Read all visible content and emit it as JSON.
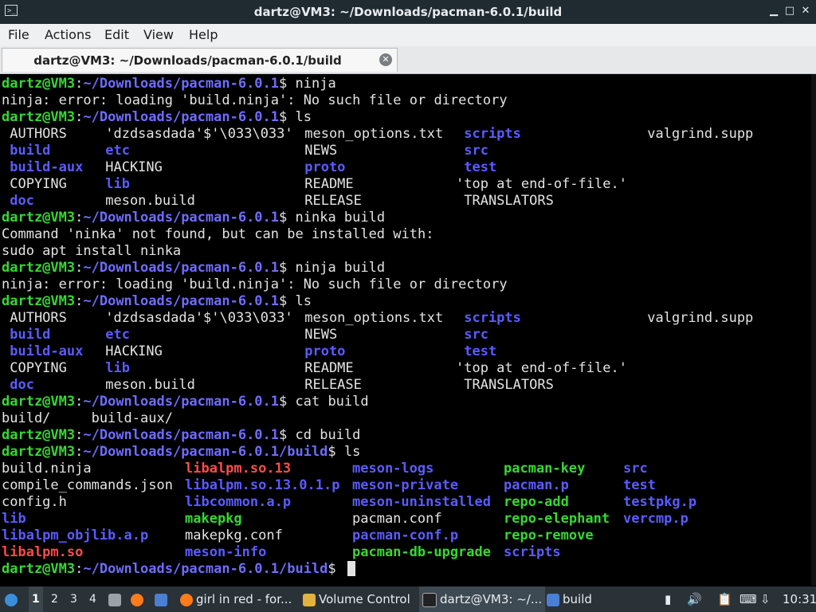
{
  "window": {
    "title": "dartz@VM3: ~/Downloads/pacman-6.0.1/build"
  },
  "menu": [
    "File",
    "Actions",
    "Edit",
    "View",
    "Help"
  ],
  "tab": {
    "label": "dartz@VM3: ~/Downloads/pacman-6.0.1/build"
  },
  "terminal": {
    "prompt_user": "dartz@VM3",
    "prompt_path1": "~/Downloads/pacman-6.0.1",
    "prompt_path2": "~/Downloads/pacman-6.0.1/build",
    "lines": [
      {
        "type": "prompt",
        "path": "~/Downloads/pacman-6.0.1",
        "cmd": " ninja"
      },
      {
        "type": "text",
        "text": "ninja: error: loading 'build.ninja': No such file or directory"
      },
      {
        "type": "prompt",
        "path": "~/Downloads/pacman-6.0.1",
        "cmd": " ls"
      },
      {
        "type": "cols",
        "cells": [
          [
            " AUTHORS",
            "w"
          ],
          [
            " 'dzdsasdada'$'\\033\\033'",
            "w"
          ],
          [
            " meson_options.txt",
            "w"
          ],
          [
            " scripts",
            "d"
          ],
          [
            " valgrind.supp",
            "w"
          ]
        ]
      },
      {
        "type": "cols",
        "cells": [
          [
            " build",
            "d"
          ],
          [
            " etc",
            "d"
          ],
          [
            " NEWS",
            "w"
          ],
          [
            " src",
            "d"
          ],
          [
            "",
            "w"
          ]
        ]
      },
      {
        "type": "cols",
        "cells": [
          [
            " build-aux",
            "d"
          ],
          [
            " HACKING",
            "w"
          ],
          [
            " proto",
            "d"
          ],
          [
            " test",
            "d"
          ],
          [
            "",
            "w"
          ]
        ]
      },
      {
        "type": "cols",
        "cells": [
          [
            " COPYING",
            "w"
          ],
          [
            " lib",
            "d"
          ],
          [
            " README",
            "w"
          ],
          [
            "'top at end-of-file.'",
            "w"
          ],
          [
            "",
            "w"
          ]
        ]
      },
      {
        "type": "cols",
        "cells": [
          [
            " doc",
            "d"
          ],
          [
            " meson.build",
            "w"
          ],
          [
            " RELEASE",
            "w"
          ],
          [
            " TRANSLATORS",
            "w"
          ],
          [
            "",
            "w"
          ]
        ]
      },
      {
        "type": "prompt",
        "path": "~/Downloads/pacman-6.0.1",
        "cmd": " ninka build"
      },
      {
        "type": "text",
        "text": "Command 'ninka' not found, but can be installed with:"
      },
      {
        "type": "text",
        "text": "sudo apt install ninka"
      },
      {
        "type": "prompt",
        "path": "~/Downloads/pacman-6.0.1",
        "cmd": " ninja build"
      },
      {
        "type": "text",
        "text": "ninja: error: loading 'build.ninja': No such file or directory"
      },
      {
        "type": "prompt",
        "path": "~/Downloads/pacman-6.0.1",
        "cmd": " ls"
      },
      {
        "type": "cols",
        "cells": [
          [
            " AUTHORS",
            "w"
          ],
          [
            " 'dzdsasdada'$'\\033\\033'",
            "w"
          ],
          [
            " meson_options.txt",
            "w"
          ],
          [
            " scripts",
            "d"
          ],
          [
            " valgrind.supp",
            "w"
          ]
        ]
      },
      {
        "type": "cols",
        "cells": [
          [
            " build",
            "d"
          ],
          [
            " etc",
            "d"
          ],
          [
            " NEWS",
            "w"
          ],
          [
            " src",
            "d"
          ],
          [
            "",
            "w"
          ]
        ]
      },
      {
        "type": "cols",
        "cells": [
          [
            " build-aux",
            "d"
          ],
          [
            " HACKING",
            "w"
          ],
          [
            " proto",
            "d"
          ],
          [
            " test",
            "d"
          ],
          [
            "",
            "w"
          ]
        ]
      },
      {
        "type": "cols",
        "cells": [
          [
            " COPYING",
            "w"
          ],
          [
            " lib",
            "d"
          ],
          [
            " README",
            "w"
          ],
          [
            "'top at end-of-file.'",
            "w"
          ],
          [
            "",
            "w"
          ]
        ]
      },
      {
        "type": "cols",
        "cells": [
          [
            " doc",
            "d"
          ],
          [
            " meson.build",
            "w"
          ],
          [
            " RELEASE",
            "w"
          ],
          [
            " TRANSLATORS",
            "w"
          ],
          [
            "",
            "w"
          ]
        ]
      },
      {
        "type": "prompt",
        "path": "~/Downloads/pacman-6.0.1",
        "cmd": " cat build"
      },
      {
        "type": "text",
        "text": "build/     build-aux/"
      },
      {
        "type": "prompt",
        "path": "~/Downloads/pacman-6.0.1",
        "cmd": " cd build"
      },
      {
        "type": "prompt",
        "path": "~/Downloads/pacman-6.0.1/build",
        "cmd": " ls"
      },
      {
        "type": "cols2",
        "cells": [
          [
            "build.ninja",
            "w"
          ],
          [
            "libalpm.so.13",
            "r"
          ],
          [
            "meson-logs",
            "d"
          ],
          [
            "pacman-key",
            "g"
          ],
          [
            "src",
            "d"
          ]
        ]
      },
      {
        "type": "cols2",
        "cells": [
          [
            "compile_commands.json",
            "w"
          ],
          [
            "libalpm.so.13.0.1.p",
            "d"
          ],
          [
            "meson-private",
            "d"
          ],
          [
            "pacman.p",
            "d"
          ],
          [
            "test",
            "d"
          ]
        ]
      },
      {
        "type": "cols2",
        "cells": [
          [
            "config.h",
            "w"
          ],
          [
            "libcommon.a.p",
            "d"
          ],
          [
            "meson-uninstalled",
            "d"
          ],
          [
            "repo-add",
            "g"
          ],
          [
            "testpkg.p",
            "d"
          ]
        ]
      },
      {
        "type": "cols2",
        "cells": [
          [
            "lib",
            "d"
          ],
          [
            "makepkg",
            "g"
          ],
          [
            "pacman.conf",
            "w"
          ],
          [
            "repo-elephant",
            "g"
          ],
          [
            "vercmp.p",
            "d"
          ]
        ]
      },
      {
        "type": "cols2",
        "cells": [
          [
            "libalpm_objlib.a.p",
            "d"
          ],
          [
            "makepkg.conf",
            "w"
          ],
          [
            "pacman-conf.p",
            "d"
          ],
          [
            "repo-remove",
            "g"
          ],
          [
            "",
            "w"
          ]
        ]
      },
      {
        "type": "cols2",
        "cells": [
          [
            "libalpm.so",
            "r"
          ],
          [
            "meson-info",
            "d"
          ],
          [
            "pacman-db-upgrade",
            "g"
          ],
          [
            "scripts",
            "d"
          ],
          [
            "",
            "w"
          ]
        ]
      },
      {
        "type": "prompt",
        "path": "~/Downloads/pacman-6.0.1/build",
        "cmd": " ",
        "cursor": true
      }
    ]
  },
  "taskbar": {
    "workspaces": [
      "1",
      "2",
      "3",
      "4"
    ],
    "tasks": [
      {
        "label": "girl in red - for...",
        "icon": "firefox-icon"
      },
      {
        "label": "Volume Control",
        "icon": "volume-control-icon"
      },
      {
        "label": "dartz@VM3: ~/...",
        "icon": "terminal-icon",
        "active": true
      },
      {
        "label": "build",
        "icon": "folder-icon"
      }
    ],
    "clock": "10:31"
  },
  "colors": {
    "user": "#36d832",
    "path": "#6f6cff",
    "dir": "#5b5bff",
    "exec": "#36d832",
    "broken_link": "#ff4b4b"
  }
}
